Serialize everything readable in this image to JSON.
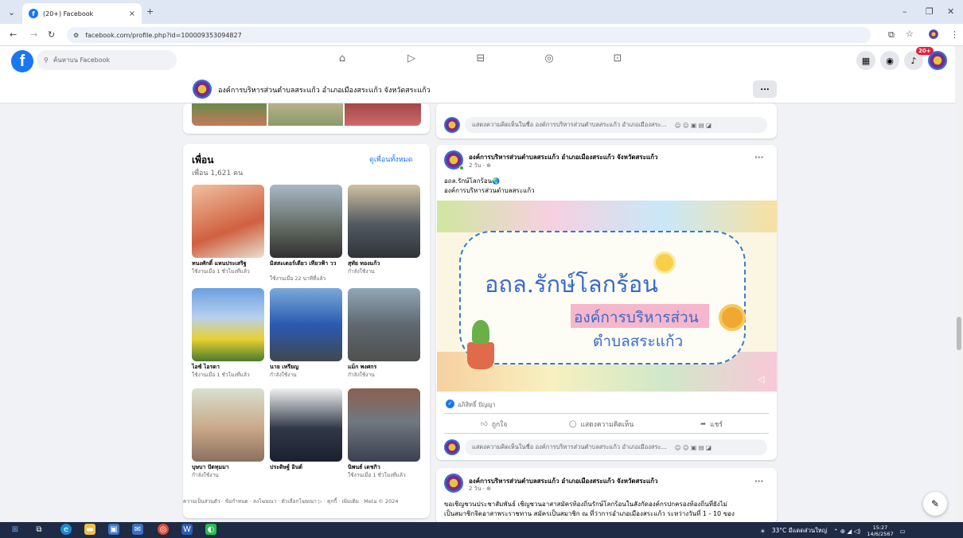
{
  "browser": {
    "tab_title": "(20+) Facebook",
    "url": "facebook.com/profile.php?id=100009353094827"
  },
  "header": {
    "search_placeholder": "ค้นหาบน Facebook",
    "notification_badge": "20+"
  },
  "page": {
    "title": "องค์การบริหารส่วนตำบลสระแก้ว อำเภอเมืองสระแก้ว จังหวัดสระแก้ว",
    "more": "..."
  },
  "friends": {
    "title": "เพื่อน",
    "see_all": "ดูเพื่อนทั้งหมด",
    "count": "เพื่อน 1,621 คน",
    "items": [
      {
        "name": "ทนงศักดิ์ แหนประเสริฐ",
        "status": "ใช้งานเมื่อ 1 ชั่วโมงที่แล้ว"
      },
      {
        "name": "มิสสะเตอร์เดียว เทียวฟ้า วว",
        "status": "ใช้งานเมื่อ 22 นาทีที่แล้ว"
      },
      {
        "name": "สุทัย ทองแก้ว",
        "status": "กำลังใช้งาน"
      },
      {
        "name": "ไอซ์ ไอรดา",
        "status": "ใช้งานเมื่อ 1 ชั่วโมงที่แล้ว"
      },
      {
        "name": "นาย เหรียญ",
        "status": "กำลังใช้งาน"
      },
      {
        "name": "แม็ก พงศกร",
        "status": "กำลังใช้งาน"
      },
      {
        "name": "บุษบา ปัตทุมมา",
        "status": "กำลังใช้งาน"
      },
      {
        "name": "ประดิษฐ์ อินต์",
        "status": ""
      },
      {
        "name": "นิพนธ์ เดชกิว",
        "status": "ใช้งานเมื่อ 1 ชั่วโมงที่แล้ว"
      }
    ]
  },
  "footer": {
    "links": "ความเป็นส่วนตัว · ข้อกำหนด · ลงโฆษณา · ตัวเลือกโฆษณา ▷ · คุกกี้ · เพิ่มเติม · Meta © 2024"
  },
  "comment_placeholder": "แสดงความคิดเห็นในชื่อ องค์การบริหารส่วนตำบลสระแก้ว อำเภอเมืองสระ...",
  "post": {
    "author": "องค์การบริหารส่วนตำบลสระแก้ว อำเภอเมืองสระแก้ว จังหวัดสระแก้ว",
    "time": "2 วัน · ",
    "line1": "อถล.รักษ์โลกร้อน🌏",
    "line2": "องค์การบริหารส่วนตำบลสระแก้ว",
    "image_title": "อถล.รักษ์โลกร้อน",
    "image_sub1": "องค์การบริหารส่วน",
    "image_sub2": "ตำบลสระแก้ว",
    "reaction": "อภิสิทธิ์ ปัญญา",
    "like": "ถูกใจ",
    "comment": "แสดงความคิดเห็น",
    "share": "แชร์"
  },
  "post3": {
    "author": "องค์การบริหารส่วนตำบลสระแก้ว อำเภอเมืองสระแก้ว จังหวัดสระแก้ว",
    "time": "2 วัน · ",
    "text1": "ขอเชิญชวนประชาสัมพันธ์ เชิญชวนอาสาสมัครท้องถิ่นรักษ์โลกร้อนในสังกัดองค์กรปกครองท้องถิ่นที่ยังไม่",
    "text2": "เป็นสมาชิกจิตอาสาพระราชทาน สมัครเป็นสมาชิก ณ ที่ว่าการอำเภอเมืองสระแก้ว ระหว่างวันที่ 1 - 10 ของ"
  },
  "taskbar": {
    "weather": "33°C มีแดดส่วนใหญ่",
    "time": "15:27",
    "date": "14/6/2567"
  },
  "colors": {
    "brand": "#1877f2",
    "bg": "#f0f2f5",
    "taskbar": "#1f2a44"
  }
}
